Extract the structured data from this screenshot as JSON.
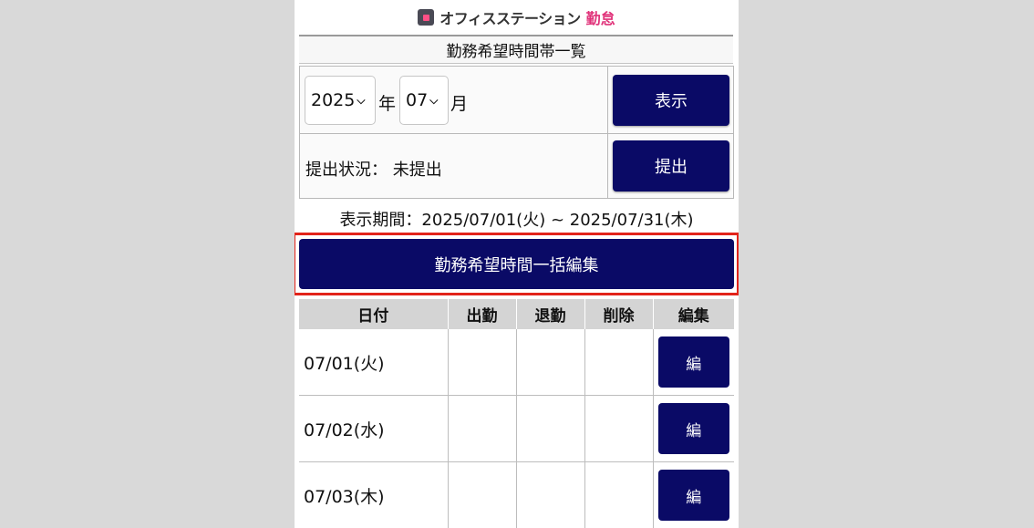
{
  "header": {
    "brand_name": "オフィスステーション",
    "brand_product": "勤怠",
    "page_title": "勤務希望時間帯一覧"
  },
  "form": {
    "year_value": "2025",
    "year_unit": "年",
    "month_value": "07",
    "month_unit": "月",
    "show_label": "表示",
    "status_label": "提出状況：",
    "status_value": "未提出",
    "submit_label": "提出"
  },
  "period_text": "表示期間：2025/07/01(火) ~ 2025/07/31(木)",
  "bulk_edit_label": "勤務希望時間一括編集",
  "table": {
    "headers": [
      "日付",
      "出勤",
      "退勤",
      "削除",
      "編集"
    ],
    "rows": [
      {
        "date": "07/01(火)",
        "start": "",
        "end": "",
        "delete": "",
        "edit_label": "編"
      },
      {
        "date": "07/02(水)",
        "start": "",
        "end": "",
        "delete": "",
        "edit_label": "編"
      },
      {
        "date": "07/03(木)",
        "start": "",
        "end": "",
        "delete": "",
        "edit_label": "編"
      }
    ]
  },
  "colors": {
    "button_navy": "#0a0a66",
    "highlight_red": "#e2231a",
    "brand_pink": "#e0337a"
  }
}
